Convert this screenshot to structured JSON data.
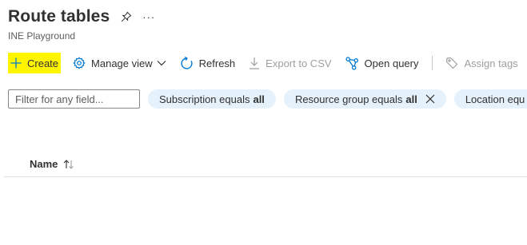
{
  "header": {
    "title": "Route tables",
    "subtitle": "INE Playground",
    "more_label": "···"
  },
  "toolbar": {
    "create": "Create",
    "manage_view": "Manage view",
    "refresh": "Refresh",
    "export_csv": "Export to CSV",
    "open_query": "Open query",
    "assign_tags": "Assign tags"
  },
  "filters": {
    "search_placeholder": "Filter for any field...",
    "pills": [
      {
        "label": "Subscription equals",
        "value": "all"
      },
      {
        "label": "Resource group equals",
        "value": "all"
      },
      {
        "label": "Location equ",
        "value": ""
      }
    ]
  },
  "table": {
    "columns": [
      {
        "label": "Name"
      }
    ]
  },
  "colors": {
    "accent": "#0078d4",
    "highlight": "#fff500",
    "pill_bg": "#e5f1fb",
    "text": "#323130",
    "disabled": "#a19f9d"
  }
}
